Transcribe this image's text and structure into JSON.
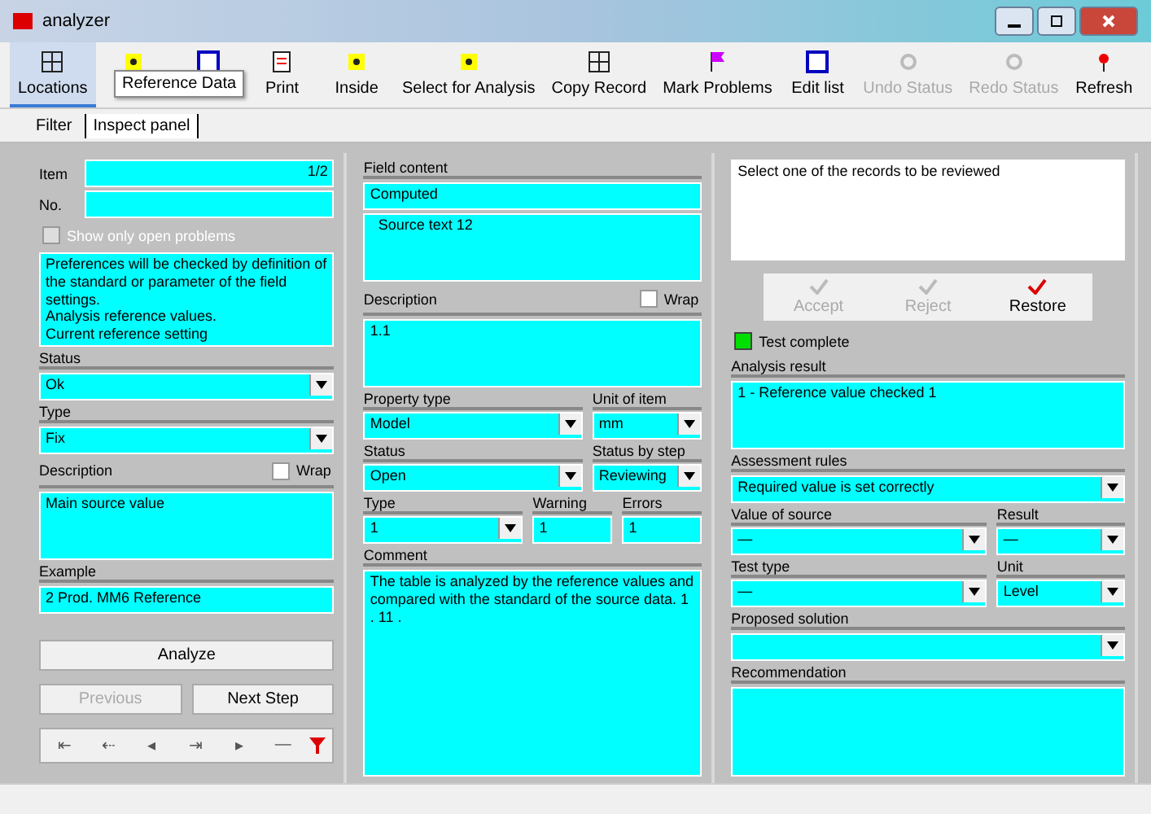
{
  "window": {
    "title": "analyzer"
  },
  "toolbar": [
    {
      "label": "Locations",
      "selected": true,
      "disabled": false
    },
    {
      "selected": false,
      "disabled": false
    },
    {
      "selected": false,
      "disabled": false
    },
    {
      "label": "Print",
      "selected": false,
      "disabled": false
    },
    {
      "label": "Inside",
      "selected": false,
      "disabled": false
    },
    {
      "label": "Select for Analysis",
      "selected": false,
      "disabled": false
    },
    {
      "label": "Copy Record",
      "selected": false,
      "disabled": false
    },
    {
      "label": "Mark Problems",
      "selected": false,
      "disabled": false
    },
    {
      "label": "Edit list",
      "selected": false,
      "disabled": false
    },
    {
      "label": "Undo Status",
      "selected": false,
      "disabled": true
    },
    {
      "label": "Redo Status",
      "selected": false,
      "disabled": true
    },
    {
      "label": "Refresh",
      "selected": false,
      "disabled": false
    }
  ],
  "tooltip": "Reference Data",
  "tabs": [
    {
      "label": "Filter",
      "selected": false
    },
    {
      "label": "Inspect panel",
      "selected": true
    }
  ],
  "left": [
    {
      "kind": "inline",
      "label": "Item",
      "value": "1/2"
    },
    {
      "kind": "inline",
      "label": "No."
    },
    {
      "kind": "check",
      "label": "Show only open problems",
      "checked": false,
      "disabled": true
    },
    {
      "kind": "memo",
      "value": "Preferences will be checked by definition of the standard or parameter of the field settings.\nAnalysis reference values.\nCurrent reference setting"
    },
    {
      "kind": "combo",
      "label": "Status",
      "value": "Ok"
    },
    {
      "kind": "combo",
      "label": "Type",
      "value": "Fix"
    },
    {
      "kind": "memo",
      "label": "Description",
      "check": {
        "label": "Wrap",
        "checked": false
      },
      "value": "Main source value"
    },
    {
      "kind": "text",
      "label": "Example",
      "value": "2 Prod. MM6 Reference"
    }
  ],
  "left_buttons": [
    {
      "label": "Analyze",
      "disabled": false
    }
  ],
  "left_pair": [
    {
      "label": "Previous",
      "disabled": true
    },
    {
      "label": "Next Step",
      "disabled": false
    }
  ],
  "nav": [
    "⇤",
    "⇠",
    "◂",
    "⇥",
    "▸",
    "—"
  ],
  "middle": [
    {
      "kind": "text",
      "label": "Field content",
      "value": "Computed"
    },
    {
      "kind": "memo",
      "value": "  Source text 12"
    },
    {
      "kind": "memo",
      "label": "Description",
      "check": {
        "label": "Wrap",
        "checked": false
      },
      "value": "1.1"
    },
    {
      "kind": "row",
      "fields": [
        {
          "kind": "combo",
          "label": "Property type",
          "value": "Model"
        },
        {
          "kind": "combo",
          "label": "Unit of item",
          "value": "mm"
        }
      ]
    },
    {
      "kind": "row",
      "fields": [
        {
          "kind": "combo",
          "label": "Status",
          "value": "Open"
        },
        {
          "kind": "combo",
          "label": "Status by step",
          "value": "Reviewing"
        }
      ]
    },
    {
      "kind": "row",
      "fields": [
        {
          "kind": "combo",
          "label": "Type",
          "value": "1"
        },
        {
          "kind": "text",
          "label": "Warning",
          "value": "1"
        },
        {
          "kind": "text",
          "label": "Errors",
          "value": "1"
        }
      ]
    },
    {
      "kind": "memo",
      "label": "Comment",
      "value": "The table is analyzed by the reference values and compared with the standard of the source data. 1 . 11 ."
    }
  ],
  "right_note": "Select one of the records to be reviewed",
  "actions": [
    {
      "label": "Accept",
      "disabled": true
    },
    {
      "label": "Reject",
      "disabled": true
    },
    {
      "label": "Restore",
      "disabled": false
    }
  ],
  "status_light": {
    "label": "Test complete",
    "color": "#00e000"
  },
  "right": [
    {
      "kind": "memo",
      "label": "Analysis result",
      "value": "1 - Reference value checked 1"
    },
    {
      "kind": "combo",
      "label": "Assessment rules",
      "value": "Required value is set correctly"
    },
    {
      "kind": "row",
      "fields": [
        {
          "kind": "combo",
          "label": "Value of source",
          "value": "—"
        },
        {
          "kind": "combo",
          "label": "Result",
          "value": "—"
        }
      ]
    },
    {
      "kind": "row",
      "fields": [
        {
          "kind": "combo",
          "label": "Test type",
          "value": "—"
        },
        {
          "kind": "combo",
          "label": "Unit",
          "value": "Level"
        }
      ]
    },
    {
      "kind": "combo",
      "label": "Proposed solution"
    },
    {
      "kind": "memo",
      "label": "Recommendation"
    }
  ]
}
